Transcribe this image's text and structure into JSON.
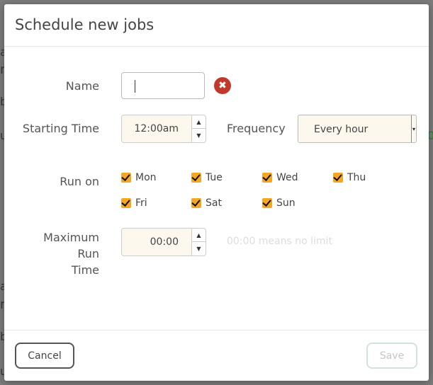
{
  "dialog": {
    "title": "Schedule new jobs",
    "name": {
      "label": "Name",
      "value": "",
      "clear_icon": "times-circle-icon",
      "clear_glyph": "✖"
    },
    "starting_time": {
      "label": "Starting Time",
      "value": "12:00am"
    },
    "frequency": {
      "label": "Frequency",
      "selected": "Every hour"
    },
    "run_on": {
      "label": "Run on",
      "days": [
        {
          "label": "Mon",
          "checked": true
        },
        {
          "label": "Tue",
          "checked": true
        },
        {
          "label": "Wed",
          "checked": true
        },
        {
          "label": "Thu",
          "checked": true
        },
        {
          "label": "Fri",
          "checked": true
        },
        {
          "label": "Sat",
          "checked": true
        },
        {
          "label": "Sun",
          "checked": true
        }
      ]
    },
    "max_run_time": {
      "label_line1": "Maximum Run",
      "label_line2": "Time",
      "value": "00:00",
      "hint": "00:00 means no limit"
    },
    "footer": {
      "cancel_label": "Cancel",
      "save_label": "Save"
    }
  },
  "colors": {
    "accent_checkbox": "#f5a623",
    "clear_button": "#c0392b",
    "input_background": "#fdf8ee"
  }
}
